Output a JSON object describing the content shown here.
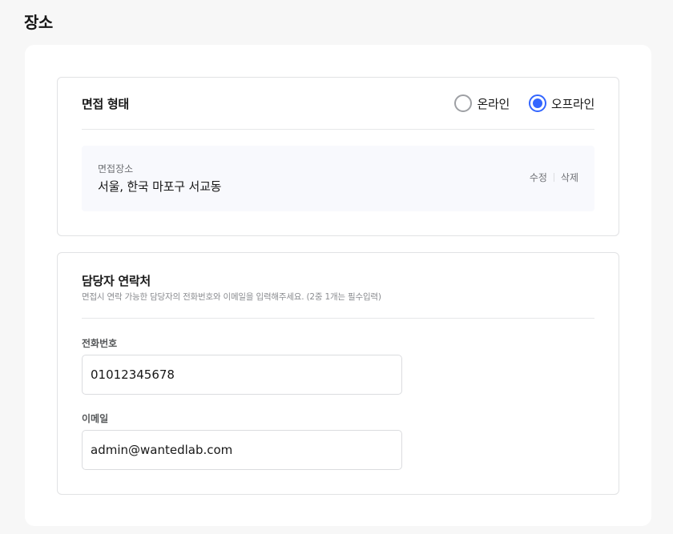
{
  "page": {
    "title": "장소"
  },
  "interview_type": {
    "label": "면접 형태",
    "options": [
      {
        "label": "온라인",
        "selected": false
      },
      {
        "label": "오프라인",
        "selected": true
      }
    ]
  },
  "location": {
    "caption": "면접장소",
    "value": "서울, 한국 마포구 서교동",
    "edit_label": "수정",
    "delete_label": "삭제"
  },
  "contact": {
    "title": "담당자 연락처",
    "description": "면접시 연락 가능한 담당자의 전화번호와 이메일을 입력해주세요. (2중 1개는 필수입력)",
    "phone": {
      "label": "전화번호",
      "value": "01012345678"
    },
    "email": {
      "label": "이메일",
      "value": "admin@wantedlab.com"
    }
  },
  "colors": {
    "accent": "#3366ff",
    "location_bg": "#f8f9fd",
    "border": "#e1e2e4"
  }
}
